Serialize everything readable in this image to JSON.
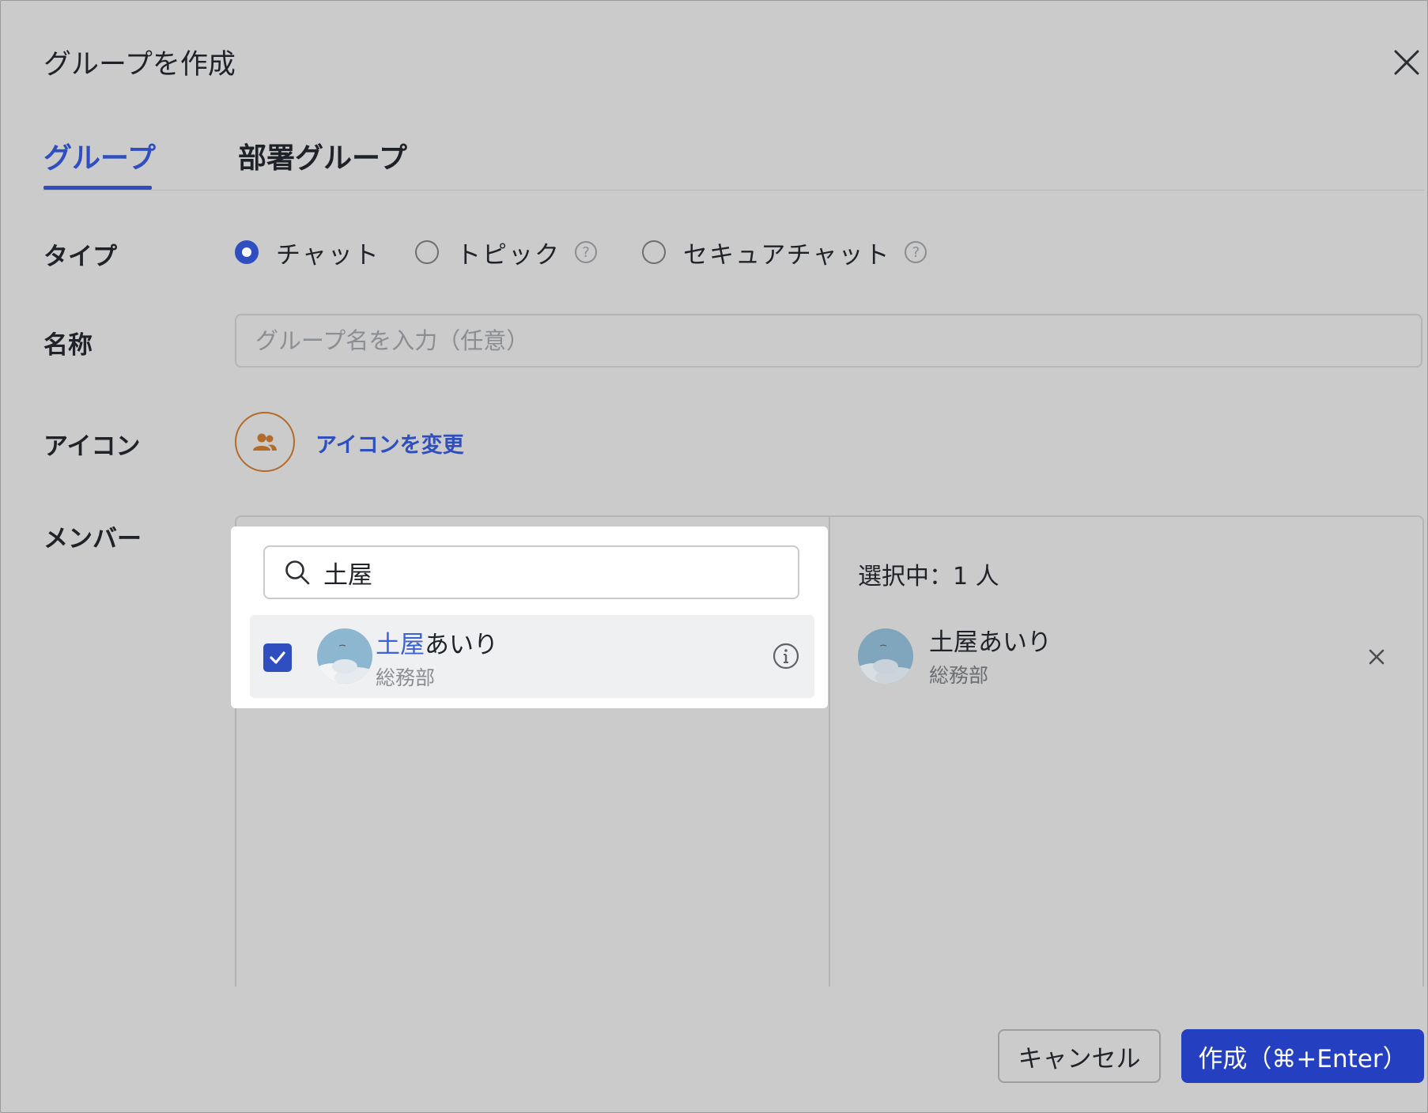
{
  "dialog": {
    "title": "グループを作成"
  },
  "tabs": [
    {
      "label": "グループ",
      "active": true
    },
    {
      "label": "部署グループ",
      "active": false
    }
  ],
  "form": {
    "type_label": "タイプ",
    "type_options": [
      {
        "label": "チャット",
        "selected": true
      },
      {
        "label": "トピック",
        "selected": false,
        "help_icon": "question-circle-icon"
      },
      {
        "label": "セキュアチャット",
        "selected": false,
        "help_icon": "question-circle-icon"
      }
    ],
    "name_label": "名称",
    "name_placeholder": "グループ名を入力（任意）",
    "name_value": "",
    "icon_label": "アイコン",
    "change_icon_link": "アイコンを変更",
    "member_label": "メンバー"
  },
  "member_search": {
    "query": "土屋",
    "results": [
      {
        "name_match": "土屋",
        "name_rest": "あいり",
        "department": "総務部",
        "checked": true
      }
    ]
  },
  "selected": {
    "count_label": "選択中：1 人",
    "members": [
      {
        "name": "土屋あいり",
        "department": "総務部"
      }
    ]
  },
  "footer": {
    "cancel_label": "キャンセル",
    "create_label": "作成（⌘+Enter）"
  },
  "colors": {
    "accent": "#2f4ec0",
    "primary_button": "#2440c0",
    "highlight_text": "#3d62d6",
    "icon_orange": "#b36b2a"
  }
}
